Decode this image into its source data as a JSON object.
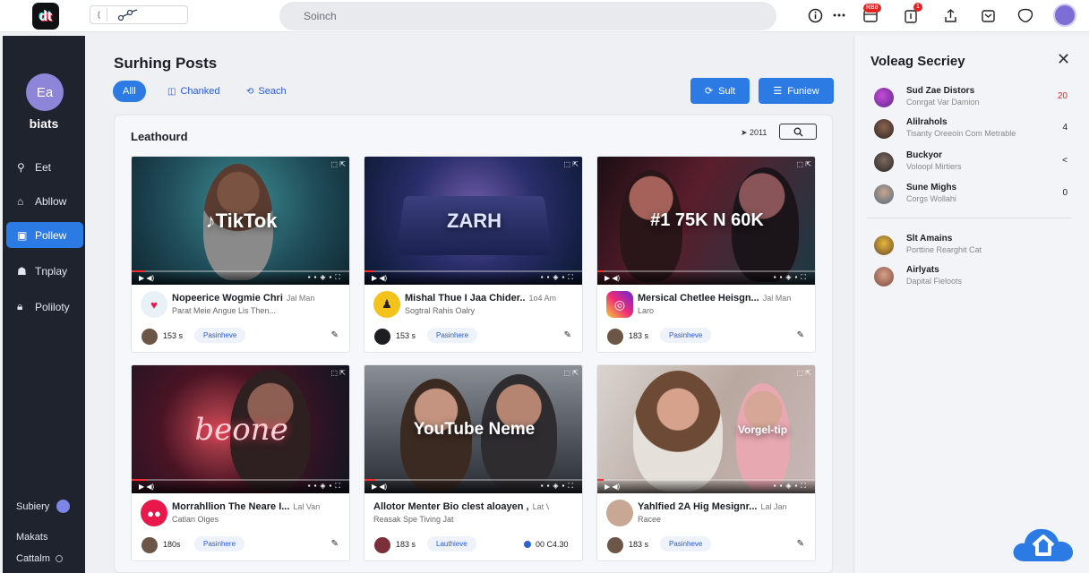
{
  "topbar": {
    "logo_text": "dt",
    "address_cursor": "(",
    "search_placeholder": "Soinch",
    "badge_1": "RB8",
    "badge_2": "1"
  },
  "sidebar": {
    "avatar_initials": "Ea",
    "name": "biats",
    "items": [
      {
        "label": "Eet",
        "icon": "search-icon"
      },
      {
        "label": "Abllow",
        "icon": "home-icon"
      },
      {
        "label": "Pollew",
        "icon": "bag-icon"
      },
      {
        "label": "Tnplay",
        "icon": "user-icon"
      },
      {
        "label": "Poliloty",
        "icon": "lock-icon"
      }
    ],
    "bottom": [
      {
        "label": "Subiery"
      },
      {
        "label": "Makats"
      },
      {
        "label": "Cattalm"
      }
    ]
  },
  "main": {
    "title": "Surhing Posts",
    "filters": [
      {
        "label": "Alll"
      },
      {
        "label": "Chanked"
      },
      {
        "label": "Seach"
      }
    ],
    "buttons": [
      {
        "label": "Sult"
      },
      {
        "label": "Funiew"
      }
    ],
    "panel": {
      "title": "Leathourd",
      "meta": "2011"
    },
    "cards": [
      {
        "thumb_text": "TikTok",
        "title": "Nopeerice Wogmie Chri",
        "time": "Jal Man",
        "subtitle": "Parat Meie Angue Lis Then...",
        "count": "153 s",
        "tag": "Pasinheve",
        "progress": 0.06,
        "channel_color": "#e8f1f5"
      },
      {
        "thumb_text": "ZARH",
        "title": "Mishal Thue I Jaa Chider..",
        "time": "1o4 Am",
        "subtitle": "Sogtral Rahis Oalry",
        "count": "153 s",
        "tag": "Pasinhere",
        "progress": 0.04,
        "channel_color": "#f3c21b"
      },
      {
        "thumb_text": "#1 75K N 60K",
        "title": "Mersical Chetlee Heisgn...",
        "time": "Jal Man",
        "subtitle": "Laro",
        "count": "183 s",
        "tag": "Pasinheve",
        "progress": 0.03,
        "channel_color": "#d62976"
      },
      {
        "thumb_text": "beone",
        "title": "Morrahllion The Neare I...",
        "time": "Lal Van",
        "subtitle": "Catlan Oiges",
        "count": "180s",
        "tag": "Pasinhere",
        "progress": 0.07,
        "channel_color": "#e8194a"
      },
      {
        "thumb_text": "YouTube Neme",
        "title": "Allotor Menter Bio clest aloayen ,",
        "time": "Lat Van",
        "subtitle": "Reasak Spe Tiving Jat",
        "count": "183 s",
        "tag": "Lauthieve",
        "stat": "00 C4.30",
        "progress": 0.05,
        "channel_color": "#ffffff"
      },
      {
        "thumb_text": "Vorgel-tip",
        "title": "Yahlfied 2A Hig Mesignr...",
        "time": "Lal Jan",
        "subtitle": "Racee",
        "count": "183 s",
        "tag": "Pasinheve",
        "progress": 0.03,
        "channel_color": "#c8a895"
      }
    ]
  },
  "right_panel": {
    "title": "Voleag Secriey",
    "items": [
      {
        "name": "Sud Zae Distors",
        "sub": "Conrgat Var Damion",
        "value": "20",
        "value_color": "#e02424"
      },
      {
        "name": "Alilrahols",
        "sub": "Tisanty Oreeoin Com Metrable",
        "value": "4"
      },
      {
        "name": "Buckyor",
        "sub": "Voloopl Mirtiers",
        "value": "<"
      },
      {
        "name": "Sune Mighs",
        "sub": "Corgs Wollahi",
        "value": "0"
      },
      {
        "name": "Slt Amains",
        "sub": "Porttine Rearghit Cat",
        "value": ""
      },
      {
        "name": "Airlyats",
        "sub": "Dapital Fieloots",
        "value": ""
      }
    ]
  },
  "colors": {
    "accent": "#2c7be5",
    "sidebar_bg": "#1f232d",
    "alert": "#e02424"
  }
}
